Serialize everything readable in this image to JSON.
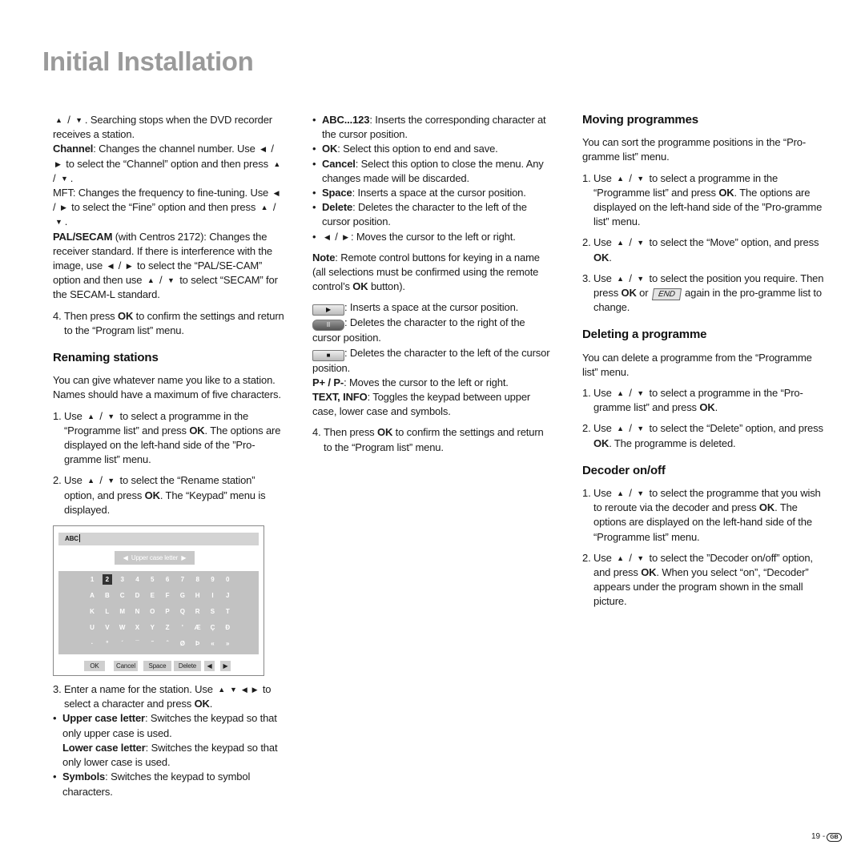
{
  "title": "Initial Installation",
  "columns": [
    {
      "blocks": [
        {
          "type": "p",
          "segs": [
            {
              "i": "up"
            },
            " / ",
            {
              "i": "down"
            },
            ". Searching stops when the DVD recorder receives a station."
          ]
        },
        {
          "type": "p",
          "segs": [
            {
              "b": "Channel"
            },
            ": Changes the channel number. Use ",
            {
              "i": "left"
            },
            " / ",
            {
              "i": "right"
            },
            " to select the “Channel” option and then press ",
            {
              "i": "up"
            },
            " / ",
            {
              "i": "down"
            },
            "."
          ]
        },
        {
          "type": "p",
          "segs": [
            "MFT: Changes the frequency to fine-tuning. Use ",
            {
              "i": "left"
            },
            " / ",
            {
              "i": "right"
            },
            " to select the “Fine” option and then press ",
            {
              "i": "up"
            },
            " / ",
            {
              "i": "down"
            },
            "."
          ]
        },
        {
          "type": "p",
          "segs": [
            {
              "b": "PAL/SECAM"
            },
            " (with Centros 2172): Changes the receiver standard. If there is interference with the image, use ",
            {
              "i": "left"
            },
            " / ",
            {
              "i": "right"
            },
            " to select the “PAL/SE-CAM” option and then use ",
            {
              "i": "up"
            },
            " / ",
            {
              "i": "down"
            },
            " to select “SECAM” for the SECAM-L standard."
          ]
        },
        {
          "type": "num",
          "num": "4.",
          "segs": [
            "Then press ",
            {
              "b": "OK"
            },
            " to confirm the settings and return to the “Program list” menu."
          ]
        },
        {
          "type": "h",
          "segs": [
            "Renaming stations"
          ]
        },
        {
          "type": "p",
          "segs": [
            "You can give whatever name you like to a station. Names should have a maximum of five characters."
          ]
        },
        {
          "type": "num",
          "num": "1.",
          "segs": [
            "Use ",
            {
              "i": "up"
            },
            " / ",
            {
              "i": "down"
            },
            " to select a programme in the “Programme list” and press ",
            {
              "b": "OK"
            },
            ". The options are displayed on the left-hand side of the ”Pro-gramme list” menu."
          ]
        },
        {
          "type": "num",
          "num": "2.",
          "segs": [
            "Use ",
            {
              "i": "up"
            },
            " / ",
            {
              "i": "down"
            },
            " to select the “Rename station” option, and press ",
            {
              "b": "OK"
            },
            ". The “Keypad” menu is displayed."
          ]
        },
        {
          "type": "fig"
        },
        {
          "type": "num",
          "num": "3.",
          "segs": [
            "Enter a name for the station. Use ",
            {
              "i": "up"
            },
            {
              "i": "down"
            },
            {
              "i": "left"
            },
            {
              "i": "right"
            },
            " to select a character and press ",
            {
              "b": "OK"
            },
            "."
          ]
        },
        {
          "type": "bullet",
          "num": "•",
          "segs": [
            {
              "b": "Upper case letter"
            },
            ": Switches the keypad so that only upper case is used."
          ]
        },
        {
          "type": "cont",
          "segs": [
            {
              "b": "Lower case letter"
            },
            ": Switches the keypad so that only lower case is used."
          ]
        },
        {
          "type": "bullet",
          "num": "•",
          "segs": [
            {
              "b": "Symbols"
            },
            ": Switches the keypad to symbol characters."
          ]
        }
      ]
    },
    {
      "blocks": [
        {
          "type": "bullet",
          "num": "•",
          "segs": [
            {
              "b": "ABC...123"
            },
            ": Inserts the corresponding character at the cursor position."
          ]
        },
        {
          "type": "bullet",
          "num": "•",
          "segs": [
            {
              "b": "OK"
            },
            ": Select this option to end and save."
          ]
        },
        {
          "type": "bullet",
          "num": "•",
          "segs": [
            {
              "b": "Cancel"
            },
            ": Select this option to close the menu. Any changes made will be discarded."
          ]
        },
        {
          "type": "bullet",
          "num": "•",
          "segs": [
            {
              "b": "Space"
            },
            ": Inserts a space at the cursor position."
          ]
        },
        {
          "type": "bullet",
          "num": "•",
          "segs": [
            {
              "b": "Delete"
            },
            ": Deletes the character to the left of the cursor position."
          ]
        },
        {
          "type": "bullet",
          "num": "•",
          "segs": [
            {
              "i": "left"
            },
            " / ",
            {
              "i": "right"
            },
            ": Moves the cursor to the left or right."
          ]
        },
        {
          "type": "p",
          "sp": true,
          "segs": [
            {
              "b": "Note"
            },
            ": Remote control buttons for keying in a name (all selections must be confirmed using the remote control’s ",
            {
              "b": "OK"
            },
            " button)."
          ]
        },
        {
          "type": "p",
          "sp": true,
          "segs": [
            {
              "i": "play"
            },
            ": Inserts a space at the cursor position."
          ]
        },
        {
          "type": "p",
          "segs": [
            {
              "i": "pause"
            },
            ": Deletes the character to the right of the cursor position."
          ]
        },
        {
          "type": "p",
          "segs": [
            {
              "i": "stop"
            },
            ": Deletes the character to the left of the cursor position."
          ]
        },
        {
          "type": "p",
          "segs": [
            {
              "b": "P+ / P-"
            },
            ": Moves the cursor to the left or right."
          ]
        },
        {
          "type": "p",
          "segs": [
            {
              "b": "TEXT, INFO"
            },
            ": Toggles the keypad between upper case, lower case and symbols."
          ]
        },
        {
          "type": "num",
          "num": "4.",
          "segs": [
            "Then press ",
            {
              "b": "OK"
            },
            " to confirm the settings and return to the “Program list” menu."
          ]
        }
      ]
    },
    {
      "blocks": [
        {
          "type": "h",
          "segs": [
            "Moving programmes"
          ]
        },
        {
          "type": "p",
          "segs": [
            "You can sort the programme positions in the “Pro-gramme list” menu."
          ]
        },
        {
          "type": "num",
          "num": "1.",
          "segs": [
            "Use ",
            {
              "i": "up"
            },
            " / ",
            {
              "i": "down"
            },
            " to select a programme in the “Programme list” and press ",
            {
              "b": "OK"
            },
            ". The options are displayed on the left-hand side of the ”Pro-gramme list” menu."
          ]
        },
        {
          "type": "num",
          "num": "2.",
          "segs": [
            "Use ",
            {
              "i": "up"
            },
            " / ",
            {
              "i": "down"
            },
            " to select the “Move” option, and press ",
            {
              "b": "OK"
            },
            "."
          ]
        },
        {
          "type": "num",
          "num": "3.",
          "segs": [
            "Use ",
            {
              "i": "up"
            },
            " / ",
            {
              "i": "down"
            },
            " to select the position you require. Then press ",
            {
              "b": "OK"
            },
            " or ",
            {
              "i": "end"
            },
            " again in the pro-gramme list to change."
          ]
        },
        {
          "type": "h",
          "segs": [
            "Deleting a programme"
          ]
        },
        {
          "type": "p",
          "segs": [
            "You can delete a programme from the “Programme list” menu."
          ]
        },
        {
          "type": "num",
          "num": "1.",
          "segs": [
            "Use ",
            {
              "i": "up"
            },
            " / ",
            {
              "i": "down"
            },
            " to select a programme in the “Pro-gramme list” and press ",
            {
              "b": "OK"
            },
            "."
          ]
        },
        {
          "type": "num",
          "num": "2.",
          "segs": [
            "Use ",
            {
              "i": "up"
            },
            " / ",
            {
              "i": "down"
            },
            " to select the “Delete” option, and press ",
            {
              "b": "OK"
            },
            ". The programme is deleted."
          ]
        },
        {
          "type": "h",
          "segs": [
            "Decoder on/off"
          ]
        },
        {
          "type": "num",
          "num": "1.",
          "segs": [
            "Use ",
            {
              "i": "up"
            },
            " / ",
            {
              "i": "down"
            },
            " to select the programme that you wish to reroute via the decoder and press ",
            {
              "b": "OK"
            },
            ". The options are displayed on the left-hand side of the “Programme list” menu."
          ]
        },
        {
          "type": "num",
          "num": "2.",
          "segs": [
            "Use ",
            {
              "i": "up"
            },
            " / ",
            {
              "i": "down"
            },
            " to select the ”Decoder on/off” option, and press ",
            {
              "b": "OK"
            },
            ". When you select “on”, “Decoder” appears under the program shown in the small picture."
          ]
        }
      ]
    }
  ],
  "icons": {
    "up": "▲",
    "down": "▼",
    "left": "◀",
    "right": "▶",
    "play": "▶",
    "pause": "II",
    "stop": "■",
    "end": "END"
  },
  "keypad": {
    "input": "ABC",
    "mode": "Upper case letter",
    "selected": "2",
    "rows": [
      [
        "1",
        "2",
        "3",
        "4",
        "5",
        "6",
        "7",
        "8",
        "9",
        "0"
      ],
      [
        "A",
        "B",
        "C",
        "D",
        "E",
        "F",
        "G",
        "H",
        "I",
        "J"
      ],
      [
        "K",
        "L",
        "M",
        "N",
        "O",
        "P",
        "Q",
        "R",
        "S",
        "T"
      ],
      [
        "U",
        "V",
        "W",
        "X",
        "Y",
        "Z",
        "'",
        "Æ",
        "Ç",
        "Ð"
      ],
      [
        "·",
        "°",
        "´",
        "¯",
        "˜",
        "ˆ",
        "Ø",
        "Þ",
        "«",
        "»"
      ]
    ],
    "buttons": [
      "OK",
      "Cancel",
      "Space",
      "Delete",
      "◀",
      "▶"
    ]
  },
  "footer": {
    "page": "19",
    "country": "GB"
  }
}
